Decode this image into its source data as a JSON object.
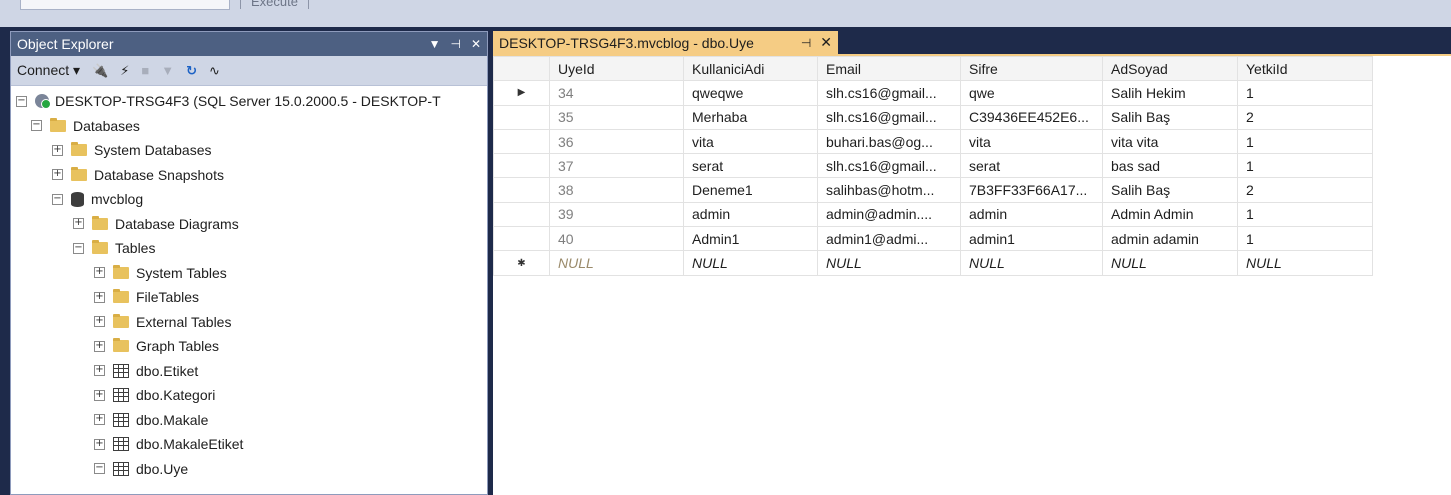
{
  "toolbar": {
    "execute_label": "Execute"
  },
  "object_explorer": {
    "title": "Object Explorer",
    "connect_label": "Connect ▾",
    "tree": [
      {
        "label": "DESKTOP-TRSG4F3 (SQL Server 15.0.2000.5 - DESKTOP-T",
        "icon": "server-icon",
        "expander": "⊟",
        "indent": 0
      },
      {
        "label": "Databases",
        "icon": "folder-icon",
        "expander": "⊟",
        "indent": 1
      },
      {
        "label": "System Databases",
        "icon": "folder-icon",
        "expander": "⊞",
        "indent": 2
      },
      {
        "label": "Database Snapshots",
        "icon": "folder-icon",
        "expander": "⊞",
        "indent": 2
      },
      {
        "label": "mvcblog",
        "icon": "database-icon",
        "expander": "⊟",
        "indent": 2
      },
      {
        "label": "Database Diagrams",
        "icon": "folder-icon",
        "expander": "⊞",
        "indent": 3
      },
      {
        "label": "Tables",
        "icon": "folder-icon",
        "expander": "⊟",
        "indent": 3
      },
      {
        "label": "System Tables",
        "icon": "folder-icon",
        "expander": "⊞",
        "indent": 4
      },
      {
        "label": "FileTables",
        "icon": "folder-icon",
        "expander": "⊞",
        "indent": 4
      },
      {
        "label": "External Tables",
        "icon": "folder-icon",
        "expander": "⊞",
        "indent": 4
      },
      {
        "label": "Graph Tables",
        "icon": "folder-icon",
        "expander": "⊞",
        "indent": 4
      },
      {
        "label": "dbo.Etiket",
        "icon": "table-icon",
        "expander": "⊞",
        "indent": 4
      },
      {
        "label": "dbo.Kategori",
        "icon": "table-icon",
        "expander": "⊞",
        "indent": 4
      },
      {
        "label": "dbo.Makale",
        "icon": "table-icon",
        "expander": "⊞",
        "indent": 4
      },
      {
        "label": "dbo.MakaleEtiket",
        "icon": "table-icon",
        "expander": "⊞",
        "indent": 4
      },
      {
        "label": "dbo.Uye",
        "icon": "table-icon",
        "expander": "⊟",
        "indent": 4
      }
    ]
  },
  "document_tab": {
    "title": "DESKTOP-TRSG4F3.mvcblog - dbo.Uye",
    "pin_glyph": "⊣",
    "close_glyph": "✕"
  },
  "grid": {
    "columns": [
      "UyeId",
      "KullaniciAdi",
      "Email",
      "Sifre",
      "AdSoyad",
      "YetkiId"
    ],
    "rows": [
      {
        "marker": "▶",
        "cells": [
          "34",
          "qweqwe",
          "slh.cs16@gmail...",
          "qwe",
          "Salih Hekim",
          "1"
        ]
      },
      {
        "marker": "",
        "cells": [
          "35",
          "Merhaba",
          "slh.cs16@gmail...",
          "C39436EE452E6...",
          "Salih Baş",
          "2"
        ]
      },
      {
        "marker": "",
        "cells": [
          "36",
          "vita",
          "buhari.bas@og...",
          "vita",
          "vita vita",
          "1"
        ]
      },
      {
        "marker": "",
        "cells": [
          "37",
          "serat",
          "slh.cs16@gmail...",
          "serat",
          "bas sad",
          "1"
        ]
      },
      {
        "marker": "",
        "cells": [
          "38",
          "Deneme1",
          "salihbas@hotm...",
          "7B3FF33F66A17...",
          "Salih Baş",
          "2"
        ]
      },
      {
        "marker": "",
        "cells": [
          "39",
          "admin",
          "admin@admin....",
          "admin",
          "Admin Admin",
          "1"
        ]
      },
      {
        "marker": "",
        "cells": [
          "40",
          "Admin1",
          "admin1@admi...",
          "admin1",
          "admin adamin",
          "1"
        ]
      }
    ],
    "new_row": {
      "marker": "✱",
      "cells": [
        "NULL",
        "NULL",
        "NULL",
        "NULL",
        "NULL",
        "NULL"
      ]
    }
  }
}
